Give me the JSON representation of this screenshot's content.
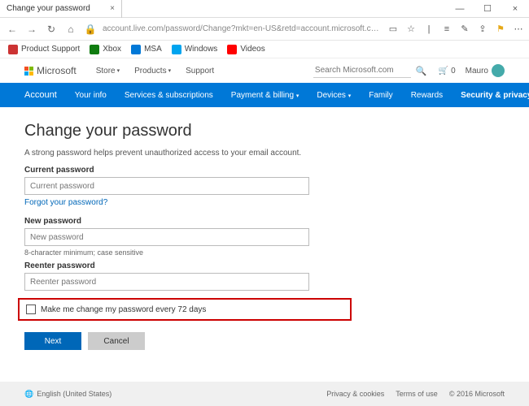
{
  "browser": {
    "tab_title": "Change your password",
    "url": "account.live.com/password/Change?mkt=en-US&retd=account.microsoft.com&refp=privacy",
    "favorites": [
      {
        "label": "Product Support"
      },
      {
        "label": "Xbox"
      },
      {
        "label": "MSA"
      },
      {
        "label": "Windows"
      },
      {
        "label": "Videos"
      }
    ]
  },
  "topnav": {
    "brand": "Microsoft",
    "links": {
      "store": "Store",
      "products": "Products",
      "support": "Support"
    },
    "search_placeholder": "Search Microsoft.com",
    "cart_count": "0",
    "user_name": "Mauro"
  },
  "bluebar": {
    "account": "Account",
    "your_info": "Your info",
    "services": "Services & subscriptions",
    "payment": "Payment & billing",
    "devices": "Devices",
    "family": "Family",
    "rewards": "Rewards",
    "security": "Security & privacy"
  },
  "page": {
    "title": "Change your password",
    "subtitle": "A strong password helps prevent unauthorized access to your email account.",
    "current_label": "Current password",
    "current_placeholder": "Current password",
    "forgot_link": "Forgot your password?",
    "new_label": "New password",
    "new_placeholder": "New password",
    "hint": "8-character minimum; case sensitive",
    "reenter_label": "Reenter password",
    "reenter_placeholder": "Reenter password",
    "checkbox_label": "Make me change my password every 72 days",
    "next_btn": "Next",
    "cancel_btn": "Cancel"
  },
  "footer": {
    "language": "English (United States)",
    "privacy": "Privacy & cookies",
    "terms": "Terms of use",
    "copyright": "© 2016 Microsoft"
  }
}
